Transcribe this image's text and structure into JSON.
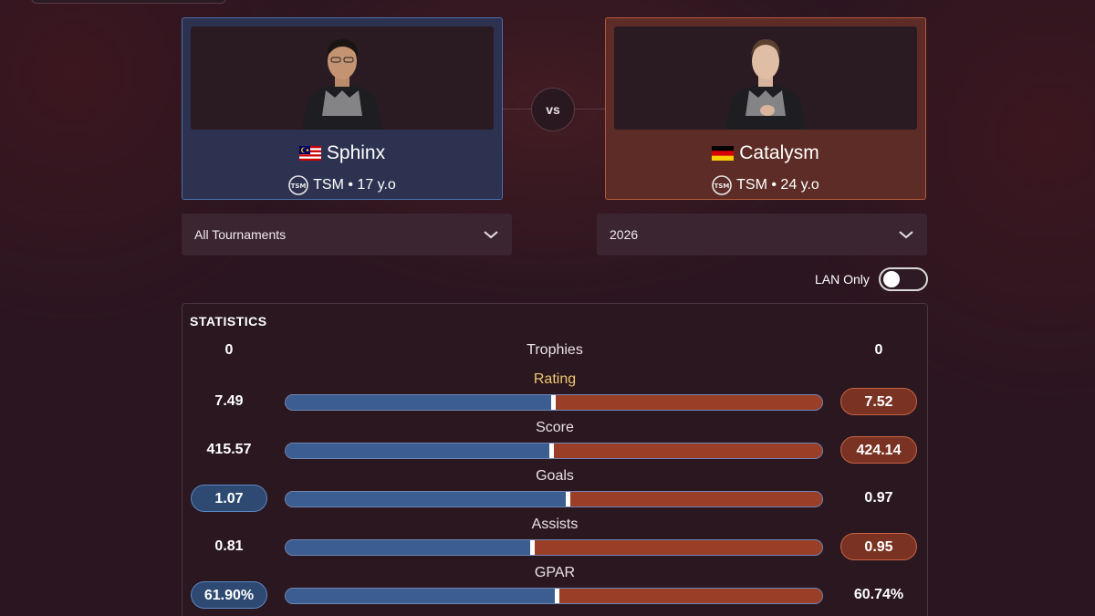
{
  "colors": {
    "background": "#2b1520",
    "player1_accent": "#4a6fa8",
    "player2_accent": "#b5583d",
    "rating_label": "#f0c870"
  },
  "player1": {
    "name": "Sphinx",
    "flag_icon": "malaysia-flag-icon",
    "team_line": "TSM • 17 y.o",
    "team_icon": "tsm-logo-icon"
  },
  "player2": {
    "name": "Catalysm",
    "flag_icon": "germany-flag-icon",
    "team_line": "TSM • 24 y.o",
    "team_icon": "tsm-logo-icon"
  },
  "vs_label": "vs",
  "filters": {
    "tournament": "All Tournaments",
    "year": "2026",
    "lan_label": "LAN Only",
    "lan_on": false
  },
  "statistics": {
    "title": "STATISTICS",
    "trophies": {
      "label": "Trophies",
      "left": "0",
      "right": "0"
    },
    "rows": [
      {
        "label": "Rating",
        "left": "7.49",
        "right": "7.52",
        "share_left": 0.498,
        "winner": "right"
      },
      {
        "label": "Score",
        "left": "415.57",
        "right": "424.14",
        "share_left": 0.495,
        "winner": "right"
      },
      {
        "label": "Goals",
        "left": "1.07",
        "right": "0.97",
        "share_left": 0.525,
        "winner": "left"
      },
      {
        "label": "Assists",
        "left": "0.81",
        "right": "0.95",
        "share_left": 0.46,
        "winner": "right"
      },
      {
        "label": "GPAR",
        "left": "61.90%",
        "right": "60.74%",
        "share_left": 0.505,
        "winner": "left"
      }
    ]
  }
}
